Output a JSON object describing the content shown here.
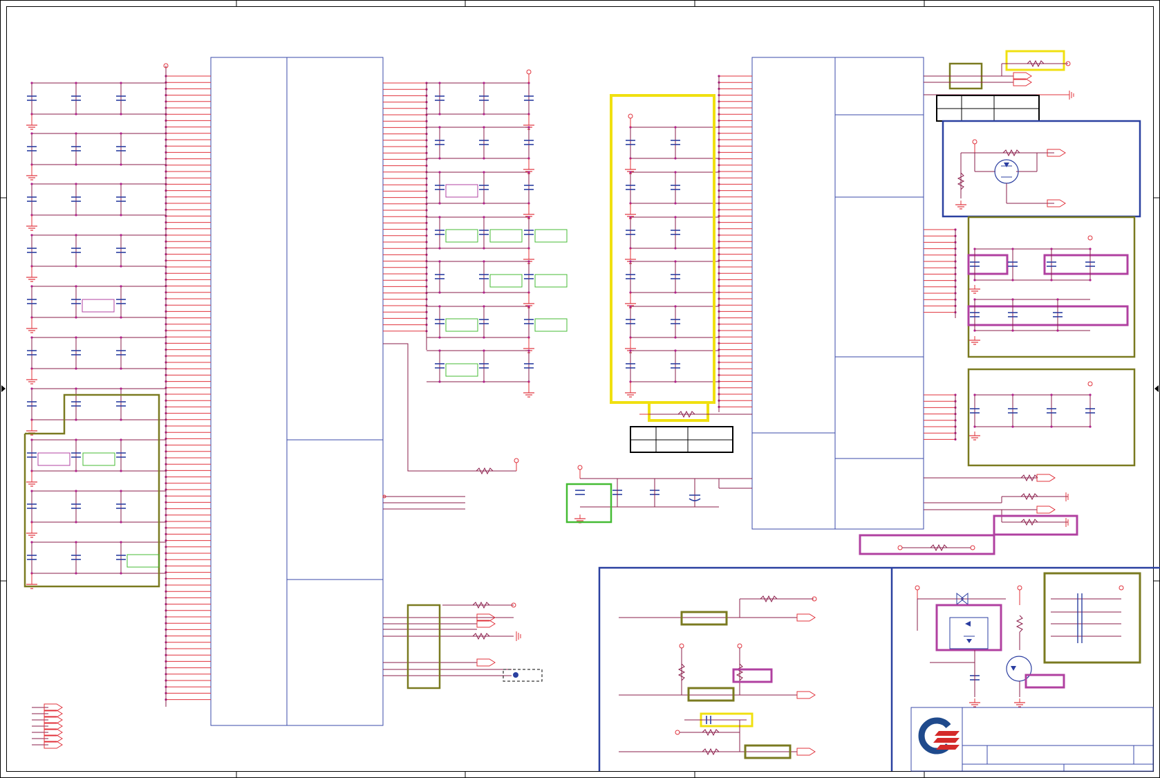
{
  "title": "",
  "sheet": {
    "border_color": "#000000",
    "zone_ticks": [
      "",
      "",
      "",
      "",
      ""
    ]
  },
  "colors": {
    "wire": "#e0303a",
    "net": "#8a1c4a",
    "symbol": "#2a3da0",
    "block_outline": "#3a4aa8",
    "highlight_yellow": "#f0e010",
    "highlight_olive": "#7a7a20",
    "highlight_green": "#44bb33",
    "highlight_magenta": "#b040a0",
    "highlight_blue": "#2a40a0",
    "logo_blue": "#1f4a8c",
    "logo_red": "#d42a2a"
  },
  "icons": {
    "logo": "company-logo-icon",
    "ground": "ground-symbol-icon",
    "capacitor": "capacitor-symbol-icon",
    "resistor": "resistor-symbol-icon",
    "mosfet": "mosfet-symbol-icon",
    "offpage": "offpage-connector-icon",
    "power": "power-pin-icon"
  },
  "title_block": {
    "title_text": "",
    "doc_number": "",
    "revision": "",
    "sheet_no": ""
  }
}
